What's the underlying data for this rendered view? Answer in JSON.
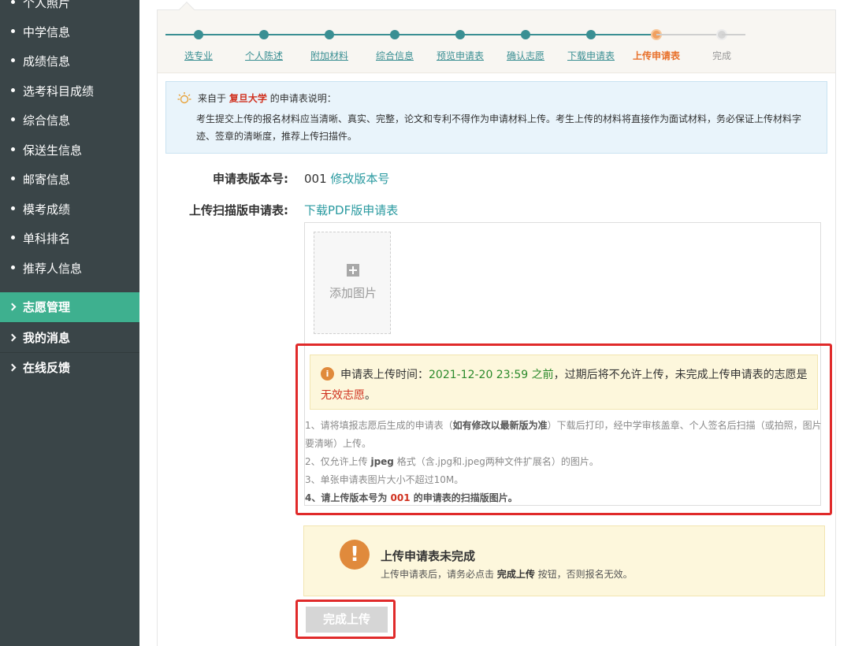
{
  "sidebar": {
    "sub_items": [
      "个人照片",
      "中学信息",
      "成绩信息",
      "选考科目成绩",
      "综合信息",
      "保送生信息",
      "邮寄信息",
      "模考成绩",
      "单科排名",
      "推荐人信息"
    ],
    "nav_items": [
      {
        "label": "志愿管理",
        "active": true
      },
      {
        "label": "我的消息",
        "active": false
      },
      {
        "label": "在线反馈",
        "active": false
      }
    ],
    "colors": {
      "bg": "#3a4548",
      "active": "#3eb08f"
    }
  },
  "steps": [
    {
      "label": "选专业",
      "state": "done"
    },
    {
      "label": "个人陈述",
      "state": "done"
    },
    {
      "label": "附加材料",
      "state": "done"
    },
    {
      "label": "综合信息",
      "state": "done"
    },
    {
      "label": "预览申请表",
      "state": "done"
    },
    {
      "label": "确认志愿",
      "state": "done"
    },
    {
      "label": "下载申请表",
      "state": "done"
    },
    {
      "label": "上传申请表",
      "state": "current"
    },
    {
      "label": "完成",
      "state": "todo"
    }
  ],
  "info": {
    "prefix": "来自于",
    "university": "复旦大学",
    "suffix": "的申请表说明：",
    "body": "考生提交上传的报名材料应当清晰、真实、完整，论文和专利不得作为申请材料上传。考生上传的材料将直接作为面试材料，务必保证上传材料字迹、签章的清晰度，推荐上传扫描件。"
  },
  "form": {
    "version_label": "申请表版本号:",
    "version_value": "001",
    "version_link": "修改版本号",
    "scan_label": "上传扫描版申请表:",
    "scan_link": "下载PDF版申请表"
  },
  "upload": {
    "add_label": "添加图片"
  },
  "warning": {
    "prefix": "申请表上传时间：",
    "time": "2021-12-20 23:59 之前",
    "middle": "，过期后将不允许上传，未完成上传申请表的志愿是",
    "red": "无效志愿",
    "end": "。"
  },
  "rules": {
    "r1_a": "1、请将填报志愿后生成的申请表（",
    "r1_b": "如有修改以最新版为准",
    "r1_c": "）下载后打印，经中学审核盖章、个人签名后扫描（或拍照，图片要清晰）上传。",
    "r2_a": "2、仅允许上传 ",
    "r2_b": "jpeg",
    "r2_c": " 格式（含.jpg和.jpeg两种文件扩展名）的图片。",
    "r3": "3、单张申请表图片大小不超过10M。",
    "r4_a": "4、请上传版本号为 ",
    "r4_b": "001",
    "r4_c": " 的申请表的扫描版图片。"
  },
  "status": {
    "icon": "!",
    "title": "上传申请表未完成",
    "sub_a": "上传申请表后，请务必点击 ",
    "sub_b": "完成上传",
    "sub_c": " 按钮，否则报名无效。"
  },
  "finish_button": "完成上传"
}
